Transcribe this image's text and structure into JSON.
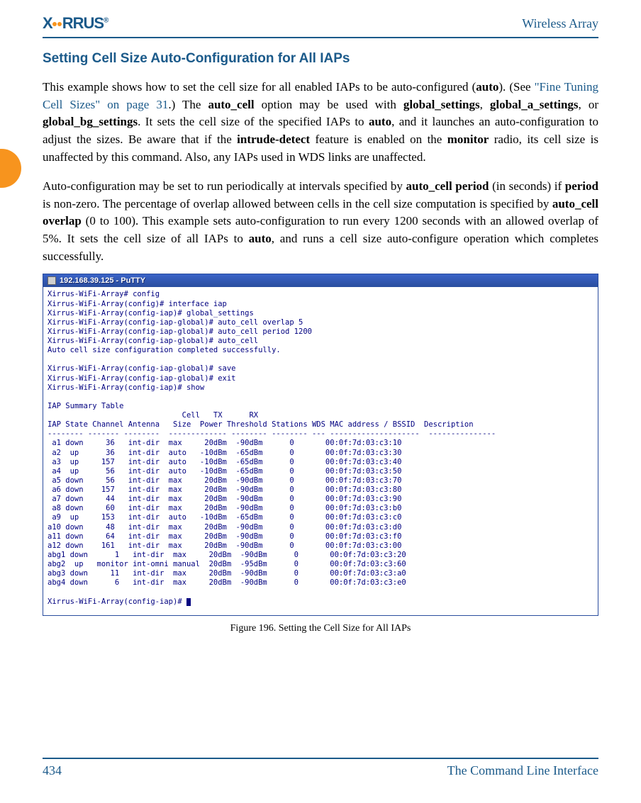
{
  "header": {
    "logo_text": "XIRRUS",
    "right": "Wireless Array"
  },
  "section_title": "Setting Cell Size Auto-Configuration for All IAPs",
  "para1": {
    "t1": "This example shows how to set the cell size for all enabled IAPs to be auto-configured (",
    "b1": "auto",
    "t2": "). (See ",
    "link1": "\"Fine Tuning Cell Sizes\" on page 31",
    "t3": ".) The ",
    "b2": "auto_cell",
    "t4": " option may be used with ",
    "b3": "global_settings",
    "t5": ", ",
    "b4": "global_a_settings",
    "t6": ", or ",
    "b5": "global_bg_settings",
    "t7": ". It sets the cell size of the specified IAPs to ",
    "b6": "auto",
    "t8": ", and it launches an auto-configuration to adjust the sizes. Be aware that if the ",
    "b7": "intrude-detect",
    "t9": " feature is enabled on the ",
    "b8": "monitor",
    "t10": " radio, its cell size is unaffected by this command. Also, any IAPs used in WDS links are unaffected."
  },
  "para2": {
    "t1": "Auto-configuration may be set to run periodically at intervals specified by ",
    "b1": "auto_cell period",
    "t2": " (in seconds) if ",
    "b2": "period",
    "t3": " is non-zero. The percentage of overlap allowed between cells in the cell size computation is specified by ",
    "b3": "auto_cell overlap",
    "t4": " (0 to 100). This example sets auto-configuration to run every 1200 seconds with an allowed overlap of 5%. It sets the cell size of all IAPs to ",
    "b4": "auto",
    "t5": ", and runs a cell size auto-configure operation which completes successfully."
  },
  "terminal": {
    "title": "192.168.39.125 - PuTTY",
    "lines_top": "Xirrus-WiFi-Array# config\nXirrus-WiFi-Array(config)# interface iap\nXirrus-WiFi-Array(config-iap)# global_settings\nXirrus-WiFi-Array(config-iap-global)# auto_cell overlap 5\nXirrus-WiFi-Array(config-iap-global)# auto_cell period 1200\nXirrus-WiFi-Array(config-iap-global)# auto_cell\nAuto cell size configuration completed successfully.\n\nXirrus-WiFi-Array(config-iap-global)# save\nXirrus-WiFi-Array(config-iap-global)# exit\nXirrus-WiFi-Array(config-iap)# show\n\nIAP Summary Table\n                              Cell   TX      RX\nIAP State Channel Antenna   Size  Power Threshold Stations WDS MAC address / BSSID  Description\n-------- ------- --------  ------------- -------- -------- --- --------------------  ---------------",
    "rows": [
      " a1 down     36   int-dir  max     20dBm  -90dBm      0       00:0f:7d:03:c3:10",
      " a2  up      36   int-dir  auto   -10dBm  -65dBm      0       00:0f:7d:03:c3:30",
      " a3  up     157   int-dir  auto   -10dBm  -65dBm      0       00:0f:7d:03:c3:40",
      " a4  up      56   int-dir  auto   -10dBm  -65dBm      0       00:0f:7d:03:c3:50",
      " a5 down     56   int-dir  max     20dBm  -90dBm      0       00:0f:7d:03:c3:70",
      " a6 down    157   int-dir  max     20dBm  -90dBm      0       00:0f:7d:03:c3:80",
      " a7 down     44   int-dir  max     20dBm  -90dBm      0       00:0f:7d:03:c3:90",
      " a8 down     60   int-dir  max     20dBm  -90dBm      0       00:0f:7d:03:c3:b0",
      " a9  up     153   int-dir  auto   -10dBm  -65dBm      0       00:0f:7d:03:c3:c0",
      "a10 down     48   int-dir  max     20dBm  -90dBm      0       00:0f:7d:03:c3:d0",
      "a11 down     64   int-dir  max     20dBm  -90dBm      0       00:0f:7d:03:c3:f0",
      "a12 down    161   int-dir  max     20dBm  -90dBm      0       00:0f:7d:03:c3:00",
      "abg1 down      1   int-dir  max     20dBm  -90dBm      0       00:0f:7d:03:c3:20",
      "abg2  up   monitor int-omni manual  20dBm  -95dBm      0       00:0f:7d:03:c3:60",
      "abg3 down     11   int-dir  max     20dBm  -90dBm      0       00:0f:7d:03:c3:a0",
      "abg4 down      6   int-dir  max     20dBm  -90dBm      0       00:0f:7d:03:c3:e0"
    ],
    "prompt": "Xirrus-WiFi-Array(config-iap)# "
  },
  "caption": "Figure 196. Setting the Cell Size for All IAPs",
  "footer": {
    "page": "434",
    "title": "The Command Line Interface"
  }
}
